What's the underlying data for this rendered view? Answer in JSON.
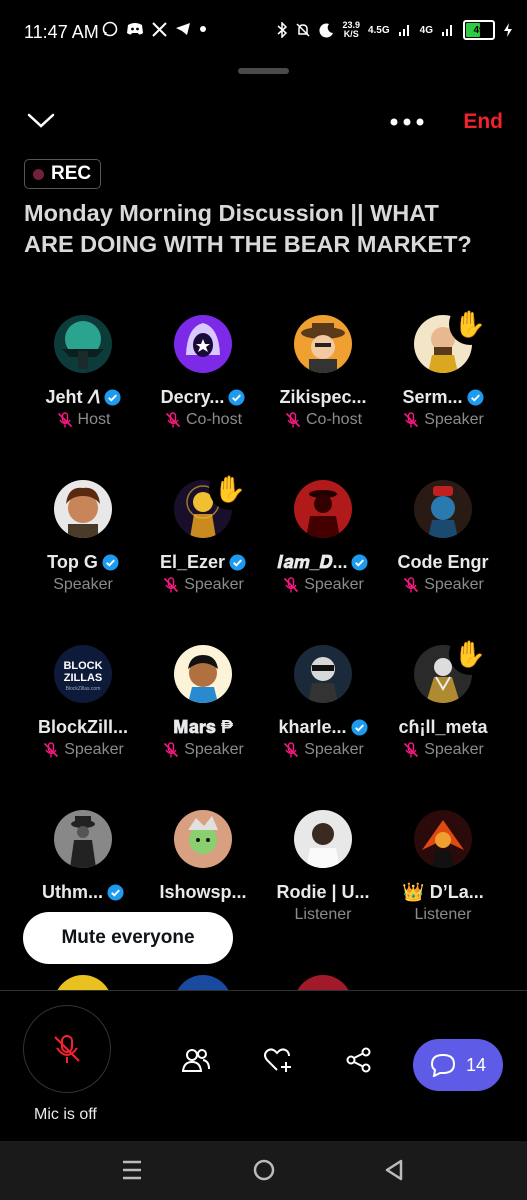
{
  "status_bar": {
    "time": "11:47 AM",
    "net_speed_value": "23.9",
    "net_speed_unit": "K/S",
    "network_1": "4.5G",
    "network_2": "4G",
    "battery": "49",
    "left_icons": [
      "whatsapp-icon",
      "discord-icon",
      "x-icon",
      "telegram-icon",
      "dot-icon"
    ],
    "right_icons": [
      "bluetooth-icon",
      "mute-icon",
      "moon-icon",
      "signal-icon",
      "signal-icon",
      "battery-icon",
      "charging-icon"
    ]
  },
  "header": {
    "end_label": "End",
    "rec_label": "REC",
    "title": "Monday Morning Discussion || WHAT ARE DOING WITH THE BEAR MARKET?"
  },
  "participants": [
    {
      "name": "Jeht 𝛬",
      "role": "Host",
      "verified": true,
      "mic_off": true,
      "hand_raised": false
    },
    {
      "name": "Decry...",
      "role": "Co-host",
      "verified": true,
      "mic_off": true,
      "hand_raised": false
    },
    {
      "name": "Zikispec...",
      "role": "Co-host",
      "verified": false,
      "mic_off": true,
      "hand_raised": false
    },
    {
      "name": "Serm...",
      "role": "Speaker",
      "verified": true,
      "mic_off": true,
      "hand_raised": true
    },
    {
      "name": "Top G",
      "role": "Speaker",
      "verified": true,
      "mic_off": false,
      "hand_raised": false
    },
    {
      "name": "El_Ezer",
      "role": "Speaker",
      "verified": true,
      "mic_off": true,
      "hand_raised": true
    },
    {
      "name": "𝑰𝒂𝒎_𝑫...",
      "role": "Speaker",
      "verified": true,
      "mic_off": true,
      "hand_raised": false
    },
    {
      "name": "Code Engr",
      "role": "Speaker",
      "verified": false,
      "mic_off": true,
      "hand_raised": false
    },
    {
      "name": "BlockZill...",
      "role": "Speaker",
      "verified": false,
      "mic_off": true,
      "hand_raised": false
    },
    {
      "name": "𝐌𝐚𝐫𝐬 ₱",
      "role": "Speaker",
      "verified": false,
      "mic_off": true,
      "hand_raised": false
    },
    {
      "name": "kharle...",
      "role": "Speaker",
      "verified": true,
      "mic_off": true,
      "hand_raised": false
    },
    {
      "name": "cɦ¡ll_meta",
      "role": "Speaker",
      "verified": false,
      "mic_off": true,
      "hand_raised": true
    },
    {
      "name": "Uthm...",
      "role": "",
      "verified": true,
      "mic_off": false,
      "hand_raised": false
    },
    {
      "name": "Ishowsp...",
      "role": "",
      "verified": false,
      "mic_off": false,
      "hand_raised": false
    },
    {
      "name": "Rodie | U...",
      "role": "Listener",
      "verified": false,
      "mic_off": false,
      "hand_raised": false
    },
    {
      "name": "👑 D’La...",
      "role": "Listener",
      "verified": false,
      "mic_off": false,
      "hand_raised": false
    }
  ],
  "avatar_logo_text": [
    "BLOCK",
    "ZILLAS",
    "BlockZillas.com"
  ],
  "mute_toast": "Mute everyone",
  "bottom_bar": {
    "mic_label": "Mic is off",
    "comment_count": "14",
    "icons": [
      "people-icon",
      "heart-plus-icon",
      "share-icon",
      "comment-icon"
    ]
  },
  "colors": {
    "accent": "#5e5ce6",
    "end": "#f4212e",
    "verified": "#1d9bf0",
    "mic_off": "#f91880"
  }
}
